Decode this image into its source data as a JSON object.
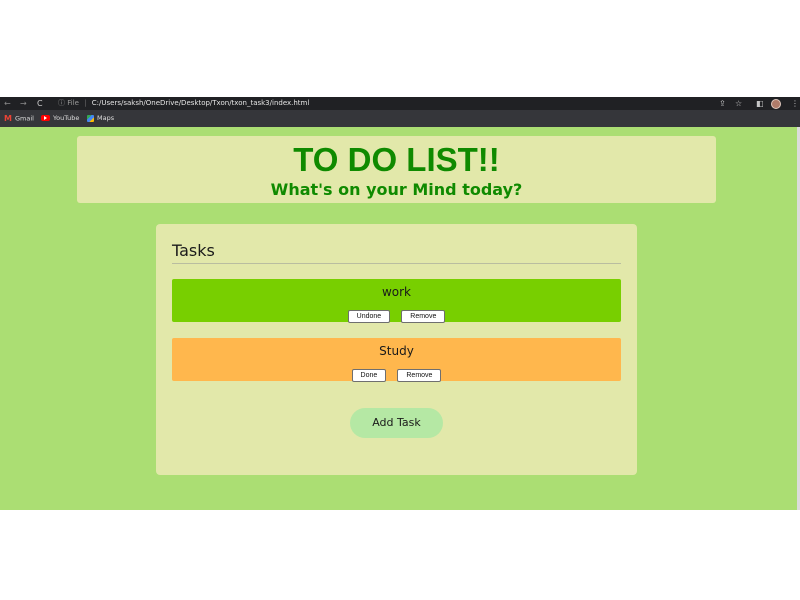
{
  "browser": {
    "address": {
      "info_label": "File",
      "url": "C:/Users/saksh/OneDrive/Desktop/Txon/txon_task3/index.html"
    },
    "bookmarks": [
      {
        "label": "Gmail",
        "icon": "gmail-icon"
      },
      {
        "label": "YouTube",
        "icon": "youtube-icon"
      },
      {
        "label": "Maps",
        "icon": "maps-icon"
      }
    ]
  },
  "page": {
    "title": "TO DO LIST!!",
    "subtitle": "What's on your Mind today?",
    "tasks_heading": "Tasks",
    "tasks": [
      {
        "name": "work",
        "toggle_label": "Undone",
        "remove_label": "Remove",
        "status_color": "#78cf00"
      },
      {
        "name": "Study",
        "toggle_label": "Done",
        "remove_label": "Remove",
        "status_color": "#ffb74d"
      }
    ],
    "add_button_label": "Add Task"
  },
  "colors": {
    "page_background": "#abde73",
    "card_background": "#e2e8aa",
    "title_color": "#0f8a00",
    "add_button_background": "#b5e8a4"
  }
}
